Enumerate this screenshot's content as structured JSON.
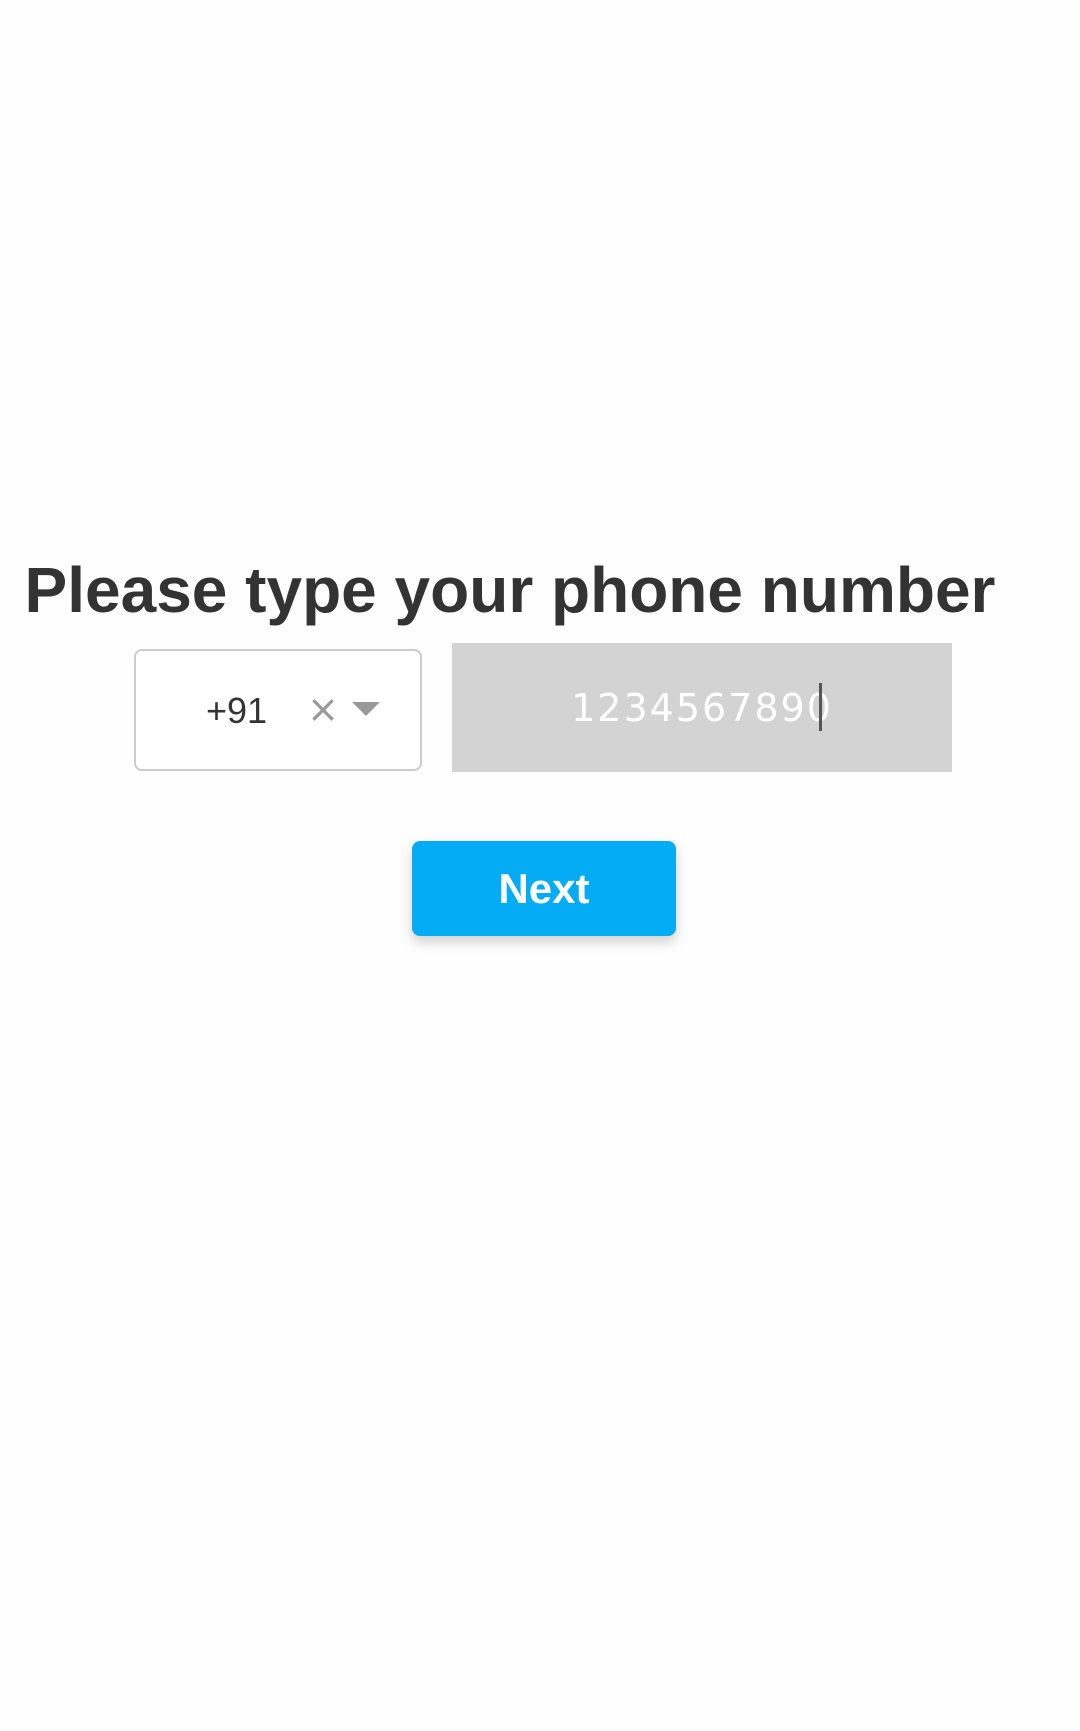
{
  "title": "Please type your phone number",
  "country_code": {
    "value": "+91",
    "clear_icon": "close-icon",
    "dropdown_icon": "chevron-down-icon"
  },
  "phone_input": {
    "value": "1234567890"
  },
  "next_button": {
    "label": "Next",
    "color": "#04acf6"
  }
}
